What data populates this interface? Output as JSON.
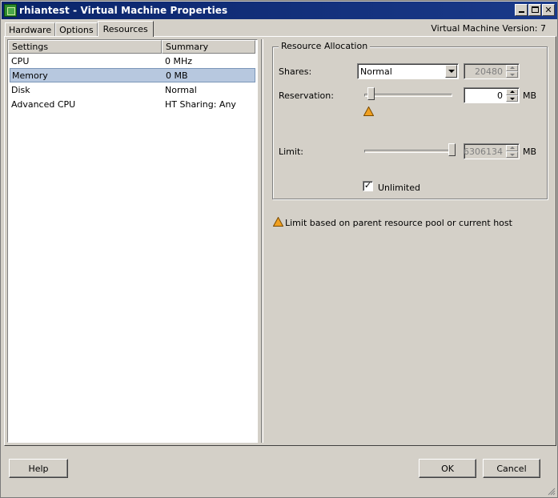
{
  "window": {
    "title": "rhiantest - Virtual Machine Properties",
    "version_label": "Virtual Machine Version: 7"
  },
  "tabs": [
    {
      "label": "Hardware",
      "active": false
    },
    {
      "label": "Options",
      "active": false
    },
    {
      "label": "Resources",
      "active": true
    }
  ],
  "settings_list": {
    "headers": [
      "Settings",
      "Summary"
    ],
    "rows": [
      {
        "setting": "CPU",
        "summary": "0 MHz",
        "selected": false
      },
      {
        "setting": "Memory",
        "summary": "0 MB",
        "selected": true
      },
      {
        "setting": "Disk",
        "summary": "Normal",
        "selected": false
      },
      {
        "setting": "Advanced CPU",
        "summary": "HT Sharing: Any",
        "selected": false
      }
    ]
  },
  "resource_allocation": {
    "title": "Resource Allocation",
    "shares_label": "Shares:",
    "shares_value": "Normal",
    "shares_number": "20480",
    "reservation_label": "Reservation:",
    "reservation_value": "0",
    "reservation_unit": "MB",
    "reservation_slider_fraction": 0.0,
    "limit_label": "Limit:",
    "limit_value": "6306134",
    "limit_unit": "MB",
    "limit_slider_fraction": 1.0,
    "unlimited_label": "Unlimited",
    "unlimited_checked": true
  },
  "note": {
    "text": "Limit based on parent resource pool or current host",
    "icon": "warning-icon",
    "icon_color": "#f0a020"
  },
  "buttons": {
    "help": "Help",
    "ok": "OK",
    "cancel": "Cancel"
  },
  "colors": {
    "titlebar": "#0a246a",
    "selection": "#b7c8df",
    "chrome": "#d4d0c8"
  }
}
